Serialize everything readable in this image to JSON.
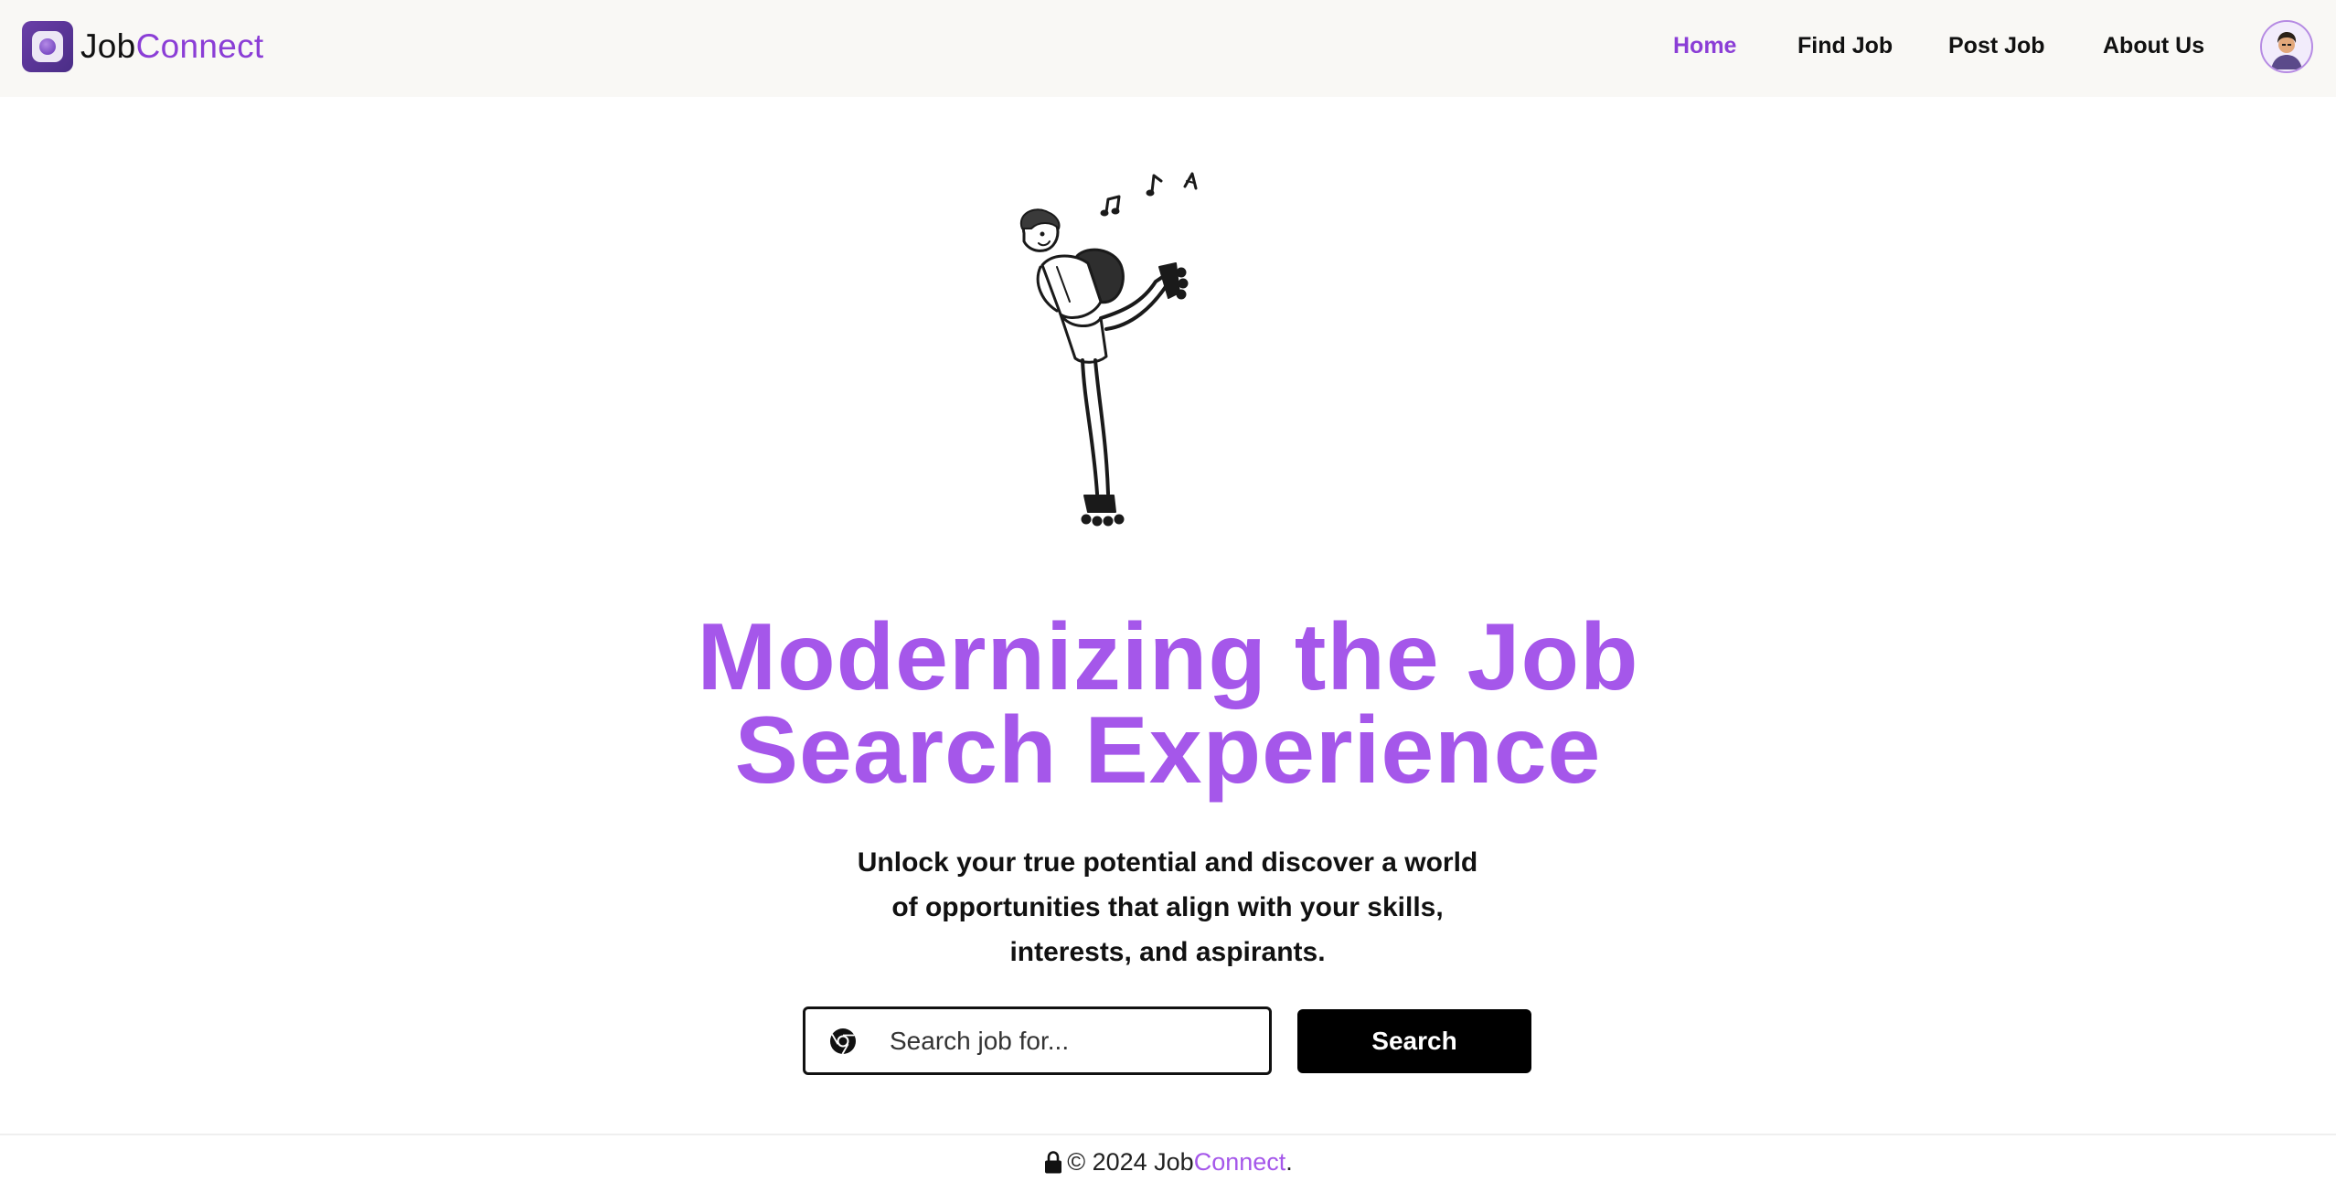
{
  "header": {
    "logo": {
      "part1": "Job",
      "part2": "Connect",
      "icon": "app-logo-icon"
    },
    "nav": [
      {
        "label": "Home",
        "active": true
      },
      {
        "label": "Find Job",
        "active": false
      },
      {
        "label": "Post Job",
        "active": false
      },
      {
        "label": "About Us",
        "active": false
      }
    ],
    "avatar_icon": "user-avatar-icon"
  },
  "hero": {
    "illustration": "skating-person-with-music-notes-illustration",
    "headline_line1": "Modernizing the Job",
    "headline_line2": "Search Experience",
    "sub_line1": "Unlock your true potential and discover a world",
    "sub_line2": "of opportunities that align with your skills,",
    "sub_line3": "interests, and aspirants."
  },
  "search": {
    "placeholder": "Search job for...",
    "value": "",
    "icon": "chrome-icon",
    "button_label": "Search"
  },
  "footer": {
    "lock_icon": "lock-icon",
    "prefix": "© 2024 Job",
    "brand_part2": "Connect",
    "suffix": "."
  },
  "colors": {
    "accent": "#a557ea",
    "nav_active": "#8b3ed6",
    "header_bg": "#f9f8f5",
    "button_bg": "#000000"
  }
}
